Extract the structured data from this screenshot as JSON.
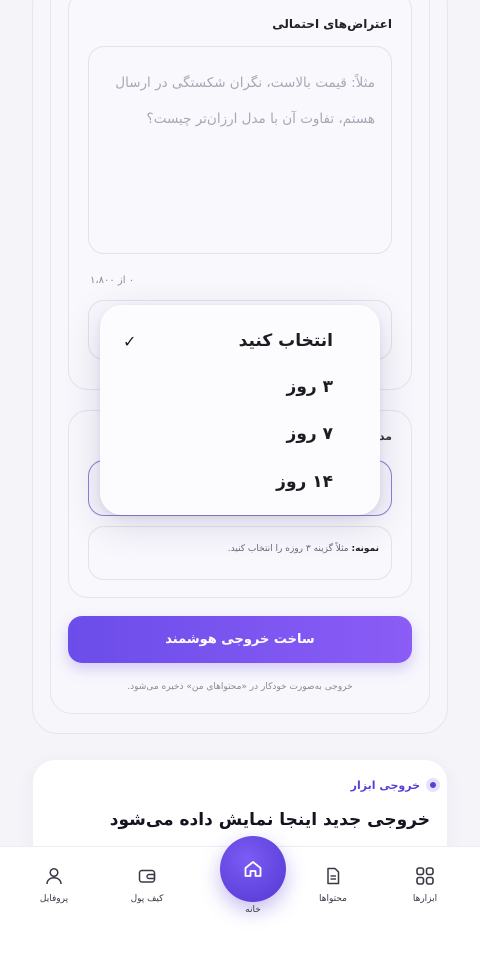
{
  "objections": {
    "label": "اعتراض‌های احتمالی",
    "placeholder_line1": "مثلاً: قیمت بالاست، نگران شکستگی در ارسال",
    "placeholder_line2": "هستم، تفاوت آن با مدل ارزان‌تر چیست؟",
    "counter": "۰ از ۱،۸۰۰"
  },
  "dropdown": {
    "items": [
      {
        "label": "انتخاب کنید",
        "selected": true
      },
      {
        "label": "۳ روز",
        "selected": false
      },
      {
        "label": "۷ روز",
        "selected": false
      },
      {
        "label": "۱۴ روز",
        "selected": false
      }
    ],
    "check_icon": "✓"
  },
  "duration": {
    "label": "مد",
    "example_bold": "نمونه:",
    "example_text": " مثلاً گزینه ۳ روزه را انتخاب کنید."
  },
  "actions": {
    "build_label": "ساخت خروجی هوشمند",
    "autosave_note": "خروجی به‌صورت خودکار در «محتواهای من» ذخیره می‌شود."
  },
  "output": {
    "tag": "خروجی ابزار",
    "title": "خروجی جدید اینجا نمایش داده می‌شود"
  },
  "nav": {
    "tools": "ابزارها",
    "contents": "محتواها",
    "home": "خانه",
    "wallet": "کیف پول",
    "profile": "پروفایل"
  },
  "colors": {
    "accent": "#6b4de9",
    "accent_light": "#8b5cf6"
  }
}
